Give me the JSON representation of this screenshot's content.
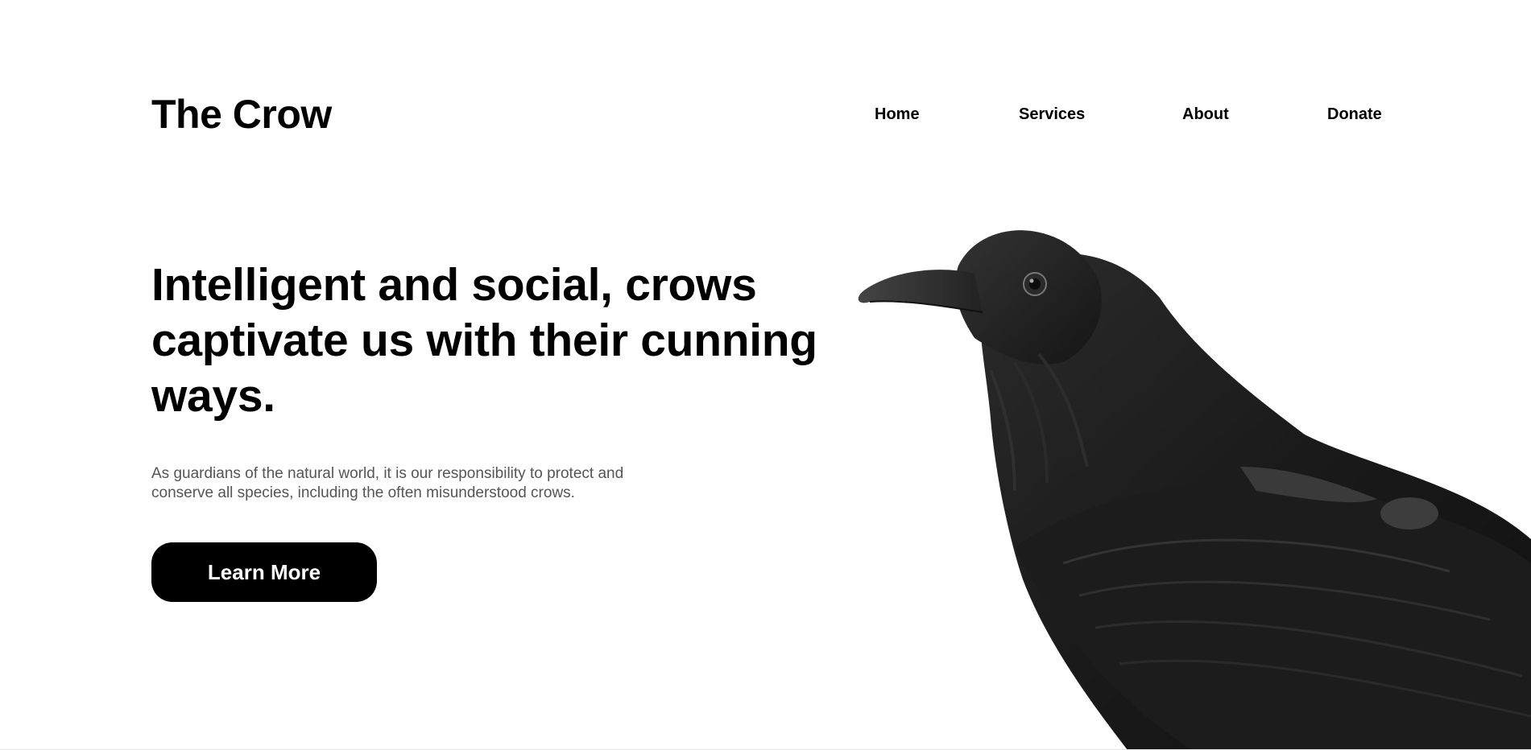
{
  "header": {
    "logo": "The Crow",
    "nav": [
      {
        "label": "Home"
      },
      {
        "label": "Services"
      },
      {
        "label": "About"
      },
      {
        "label": "Donate"
      }
    ]
  },
  "hero": {
    "headline": "Intelligent and social, crows captivate us with their cunning ways.",
    "subtext": "As guardians of the natural world, it is our responsibility to protect and conserve all species, including the often misunderstood crows.",
    "cta_label": "Learn More"
  },
  "colors": {
    "background": "#ffffff",
    "text": "#000000",
    "muted_text": "#555555",
    "button_bg": "#000000",
    "button_text": "#ffffff"
  }
}
